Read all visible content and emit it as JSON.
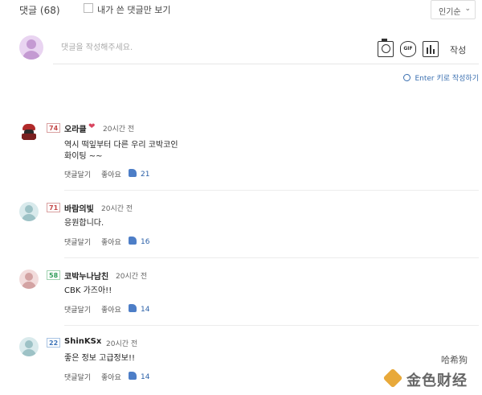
{
  "header": {
    "title": "댓글 (68)",
    "my_comments_label": "내가 쓴 댓글만 보기",
    "sort_label": "인기순",
    "sort_arrow": "⌄"
  },
  "composer": {
    "placeholder": "댓글을 작성해주세요.",
    "gif_label": "GIF",
    "submit_label": "작성",
    "enter_hint": "Enter 키로 작성하기"
  },
  "comments": [
    {
      "level": "74",
      "nickname": "오라클",
      "badge": "❤",
      "time": "20시간 전",
      "body_lines": [
        "역시 떡잎부터 다른 우리 코박코인",
        "화이팅 ~~"
      ],
      "reply_label": "댓글달기",
      "like_label": "좋아요",
      "like_count": "21"
    },
    {
      "level": "71",
      "nickname": "바람의빛",
      "time": "20시간 전",
      "body_lines": [
        "응원합니다."
      ],
      "reply_label": "댓글달기",
      "like_label": "좋아요",
      "like_count": "16"
    },
    {
      "level": "58",
      "nickname": "코박누나남친",
      "time": "20시간 전",
      "body_lines": [
        "CBK 가즈아!!"
      ],
      "reply_label": "댓글달기",
      "like_label": "좋아요",
      "like_count": "14"
    },
    {
      "level": "22",
      "nickname": "ShinKSx",
      "time": "20시간 전",
      "body_lines": [
        "좋은 정보 고급정보!!"
      ],
      "reply_label": "댓글달기",
      "like_label": "좋아요",
      "like_count": "14"
    }
  ],
  "watermark": {
    "line1": "哈希狗",
    "line2": "金色财经"
  },
  "colors": {
    "link_blue": "#2c61a8",
    "level_red": "#c44a4a",
    "level_green": "#2e9c58",
    "level_blue": "#3c73b8"
  }
}
